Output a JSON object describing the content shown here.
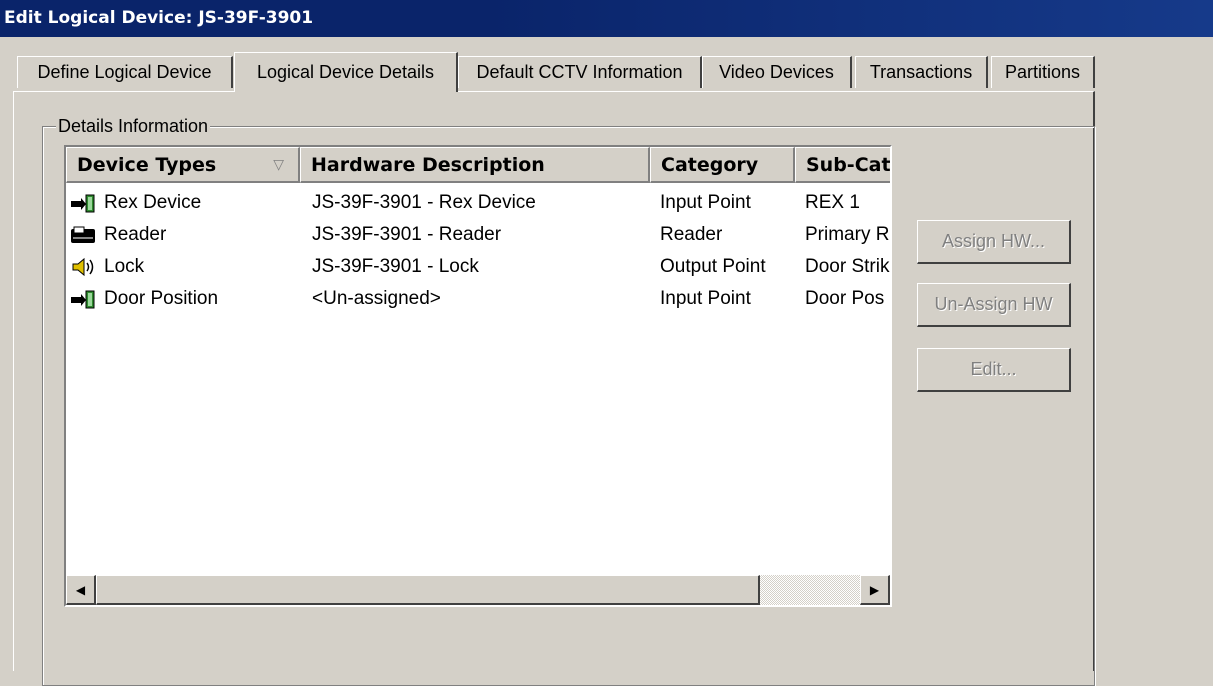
{
  "window": {
    "title": "Edit Logical Device: JS-39F-3901"
  },
  "tabs": [
    {
      "label": "Define Logical Device"
    },
    {
      "label": "Logical Device Details"
    },
    {
      "label": "Default CCTV Information"
    },
    {
      "label": "Video Devices"
    },
    {
      "label": "Transactions"
    },
    {
      "label": "Partitions"
    }
  ],
  "active_tab": "Logical Device Details",
  "group": {
    "label": "Details Information"
  },
  "list": {
    "columns": [
      {
        "label": "Device Types",
        "sort_indicator": "▽"
      },
      {
        "label": "Hardware Description"
      },
      {
        "label": "Category"
      },
      {
        "label": "Sub-Cat"
      }
    ],
    "rows": [
      {
        "icon": "input-point-icon",
        "device_type": "Rex Device",
        "hardware": "JS-39F-3901 - Rex Device",
        "category": "Input Point",
        "sub_category": "REX 1"
      },
      {
        "icon": "reader-icon",
        "device_type": "Reader",
        "hardware": "JS-39F-3901 - Reader",
        "category": "Reader",
        "sub_category": "Primary R"
      },
      {
        "icon": "speaker-icon",
        "device_type": "Lock",
        "hardware": "JS-39F-3901 - Lock",
        "category": "Output Point",
        "sub_category": "Door Strik"
      },
      {
        "icon": "input-point-icon",
        "device_type": "Door Position",
        "hardware": "<Un-assigned>",
        "category": "Input Point",
        "sub_category": "Door Pos"
      }
    ]
  },
  "buttons": {
    "assign": "Assign HW...",
    "unassign": "Un-Assign HW",
    "edit": "Edit..."
  },
  "colors": {
    "titlebar": "#0a246a",
    "face": "#d4d0c8",
    "disabled_text": "#808080"
  }
}
